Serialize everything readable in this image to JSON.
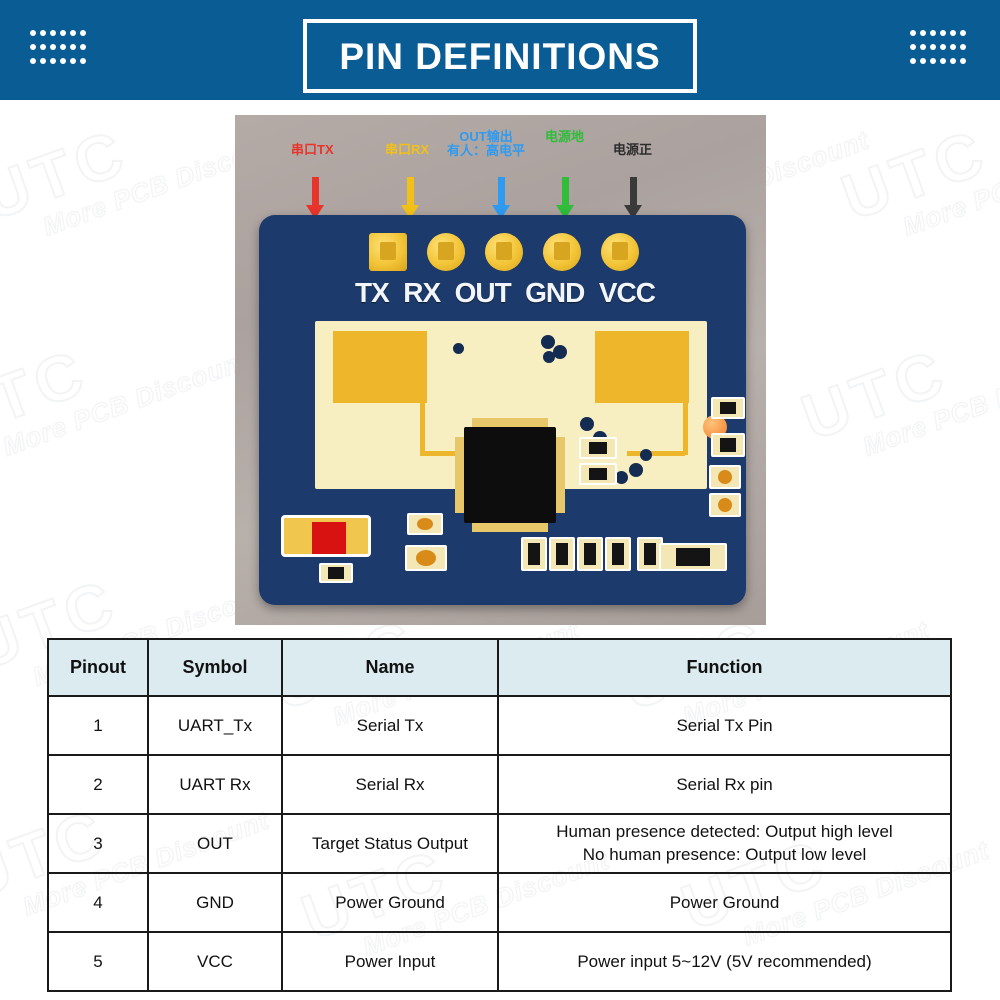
{
  "header": {
    "title": "PIN DEFINITIONS",
    "accent_color": "#0a5c94",
    "dot_count": 18
  },
  "photo": {
    "callouts": [
      {
        "name": "serial-tx",
        "text": "串口TX",
        "color": "#e8342a"
      },
      {
        "name": "serial-rx",
        "text": "串口RX",
        "color": "#f2c018"
      },
      {
        "name": "out-output",
        "line1": "OUT输出",
        "line2": "有人：高电平",
        "color": "#2f9bf0"
      },
      {
        "name": "power-ground",
        "text": "电源地",
        "color": "#2fbd3a"
      },
      {
        "name": "power-positive",
        "text": "电源正",
        "color": "#2c2c2c"
      }
    ],
    "silkscreen_pins": [
      "TX",
      "RX",
      "OUT",
      "GND",
      "VCC"
    ]
  },
  "table": {
    "headers": [
      "Pinout",
      "Symbol",
      "Name",
      "Function"
    ],
    "header_bg": "#dcebf0",
    "rows": [
      {
        "pinout": "1",
        "symbol": "UART_Tx",
        "name": "Serial Tx",
        "function": "Serial Tx Pin"
      },
      {
        "pinout": "2",
        "symbol": "UART Rx",
        "name": "Serial Rx",
        "function": "Serial Rx pin"
      },
      {
        "pinout": "3",
        "symbol": "OUT",
        "name": "Target Status Output",
        "function_line1": "Human presence detected: Output high level",
        "function_line2": "No human presence: Output low level"
      },
      {
        "pinout": "4",
        "symbol": "GND",
        "name": "Power Ground",
        "function": "Power Ground"
      },
      {
        "pinout": "5",
        "symbol": "VCC",
        "name": "Power Input",
        "function": "Power input 5~12V (5V recommended)"
      }
    ]
  },
  "watermark": {
    "brand": "UTC",
    "tagline": "More PCB Discount"
  }
}
